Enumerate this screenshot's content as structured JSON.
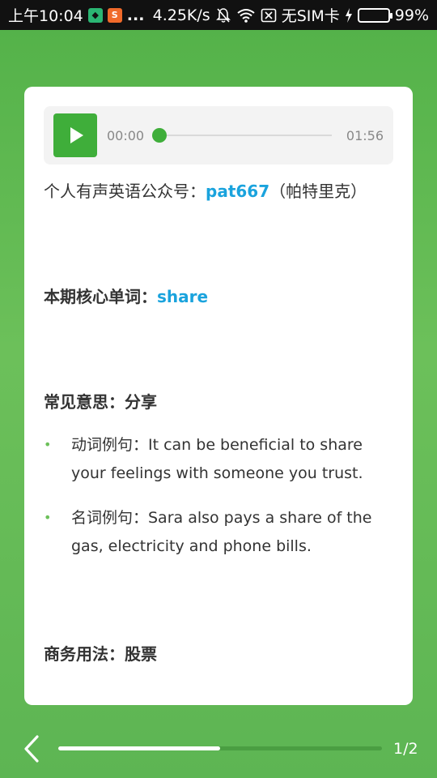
{
  "status_bar": {
    "time": "上午10:04",
    "dots": "...",
    "speed": "4.25K/s",
    "sim": "无SIM卡",
    "battery": "99%",
    "battery_level": 0.99
  },
  "player": {
    "current_time": "00:00",
    "total_time": "01:56",
    "progress": 0
  },
  "article": {
    "line1_prefix": "个人有声英语公众号：",
    "line1_account": "pat667",
    "line1_suffix": "（帕特里克）",
    "core_word_label": "本期核心单词：",
    "core_word": "share",
    "common_meaning": "常见意思：分享",
    "examples": [
      {
        "bullet": "•",
        "text": "动词例句：It can be beneficial to share your feelings with someone you trust."
      },
      {
        "bullet": "•",
        "text": "名词例句：Sara also pays a share of the gas, electricity and phone bills."
      }
    ],
    "business_usage": "商务用法：股票"
  },
  "footer": {
    "page_indicator": "1/2",
    "page_progress": 0.5
  },
  "colors": {
    "accent_green": "#3fae3a",
    "link_blue": "#1aa3dd"
  }
}
